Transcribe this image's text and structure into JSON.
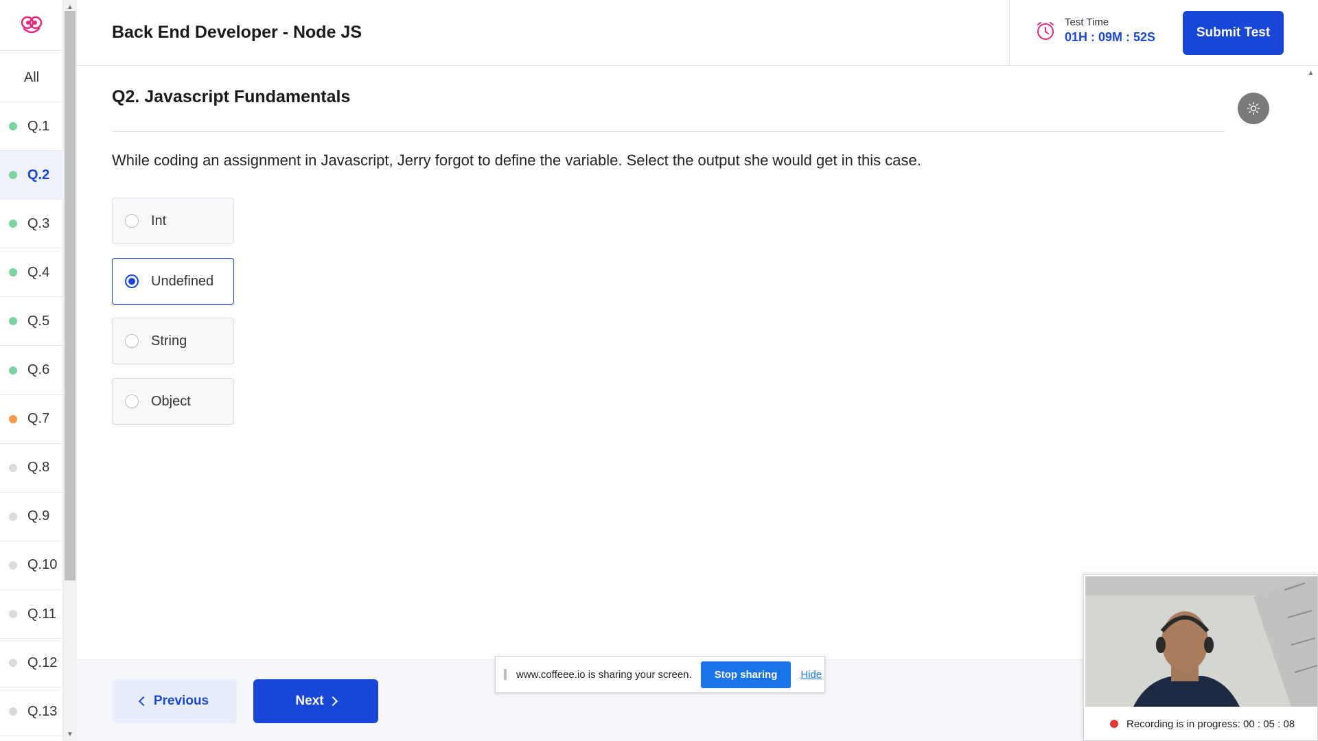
{
  "header": {
    "title": "Back End Developer - Node JS",
    "timer_label": "Test Time",
    "timer_value": "01H : 09M : 52S",
    "submit_label": "Submit Test"
  },
  "sidebar": {
    "all_label": "All",
    "items": [
      {
        "label": "Q.1",
        "status": "answered",
        "color": "#7dd3a0"
      },
      {
        "label": "Q.2",
        "status": "answered",
        "color": "#7dd3a0",
        "active": true
      },
      {
        "label": "Q.3",
        "status": "answered",
        "color": "#7dd3a0"
      },
      {
        "label": "Q.4",
        "status": "answered",
        "color": "#7dd3a0"
      },
      {
        "label": "Q.5",
        "status": "answered",
        "color": "#7dd3a0"
      },
      {
        "label": "Q.6",
        "status": "answered",
        "color": "#7dd3a0"
      },
      {
        "label": "Q.7",
        "status": "flagged",
        "color": "#f2994a"
      },
      {
        "label": "Q.8",
        "status": "unanswered",
        "color": "#d7d9dc"
      },
      {
        "label": "Q.9",
        "status": "unanswered",
        "color": "#d7d9dc"
      },
      {
        "label": "Q.10",
        "status": "unanswered",
        "color": "#d7d9dc"
      },
      {
        "label": "Q.11",
        "status": "unanswered",
        "color": "#d7d9dc"
      },
      {
        "label": "Q.12",
        "status": "unanswered",
        "color": "#d7d9dc"
      },
      {
        "label": "Q.13",
        "status": "unanswered",
        "color": "#d7d9dc"
      }
    ]
  },
  "question": {
    "heading": "Q2. Javascript Fundamentals",
    "text": "While coding an assignment in Javascript, Jerry forgot to define the variable. Select the output she would get in this case.",
    "options": [
      {
        "label": "Int",
        "selected": false
      },
      {
        "label": "Undefined",
        "selected": true
      },
      {
        "label": "String",
        "selected": false
      },
      {
        "label": "Object",
        "selected": false
      }
    ]
  },
  "footer": {
    "prev_label": "Previous",
    "next_label": "Next"
  },
  "screen_share": {
    "message": "www.coffeee.io is sharing your screen.",
    "stop_label": "Stop sharing",
    "hide_label": "Hide"
  },
  "webcam": {
    "status": "Recording is in progress: 00 : 05 : 08"
  },
  "colors": {
    "primary": "#1846d6",
    "timer_icon": "#e8247c",
    "logo": "#e8247c"
  }
}
